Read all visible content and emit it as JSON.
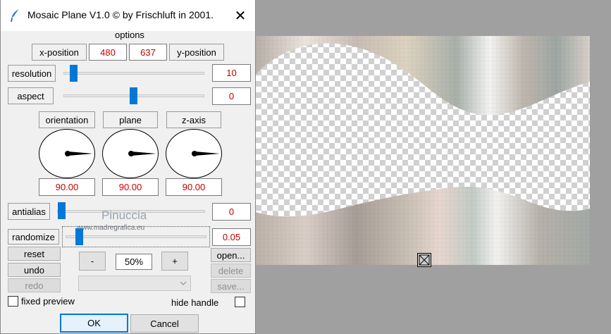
{
  "dialog": {
    "title": "Mosaic Plane V1.0 © by Frischluft in 2001.",
    "close_glyph": "✕",
    "app_icon": "feather-icon",
    "options_label": "options",
    "position": {
      "x_label": "x-position",
      "x_value": "480",
      "y_value": "637",
      "y_label": "y-position"
    },
    "resolution": {
      "label": "resolution",
      "value": "10",
      "level": 0.05
    },
    "aspect": {
      "label": "aspect",
      "value": "0",
      "level": 0.5
    },
    "dials": [
      {
        "label": "orientation",
        "value": "90.00"
      },
      {
        "label": "plane",
        "value": "90.00"
      },
      {
        "label": "z-axis",
        "value": "90.00"
      }
    ],
    "antialias": {
      "label": "antialias",
      "value": "0",
      "level": 0.0
    },
    "randomize": {
      "label": "randomize",
      "value": "0.05",
      "level": 0.05
    },
    "watermark": {
      "line1": "Pinuccia",
      "line2": "www.madregrafica.eu"
    },
    "buttons": {
      "reset": "reset",
      "undo": "undo",
      "redo": "redo",
      "minus": "-",
      "zoom": "50%",
      "plus": "+",
      "open": "open...",
      "delete": "delete",
      "save": "save...",
      "ok": "OK",
      "cancel": "Cancel"
    },
    "preset_dropdown": {
      "value": ""
    },
    "fixed_preview": {
      "label": "fixed preview",
      "checked": false
    },
    "hide_handle": {
      "label": "hide handle",
      "checked": false
    }
  },
  "colors": {
    "accent": "#0078d7",
    "value_text": "#c40000",
    "workspace": "#a0a0a0"
  }
}
